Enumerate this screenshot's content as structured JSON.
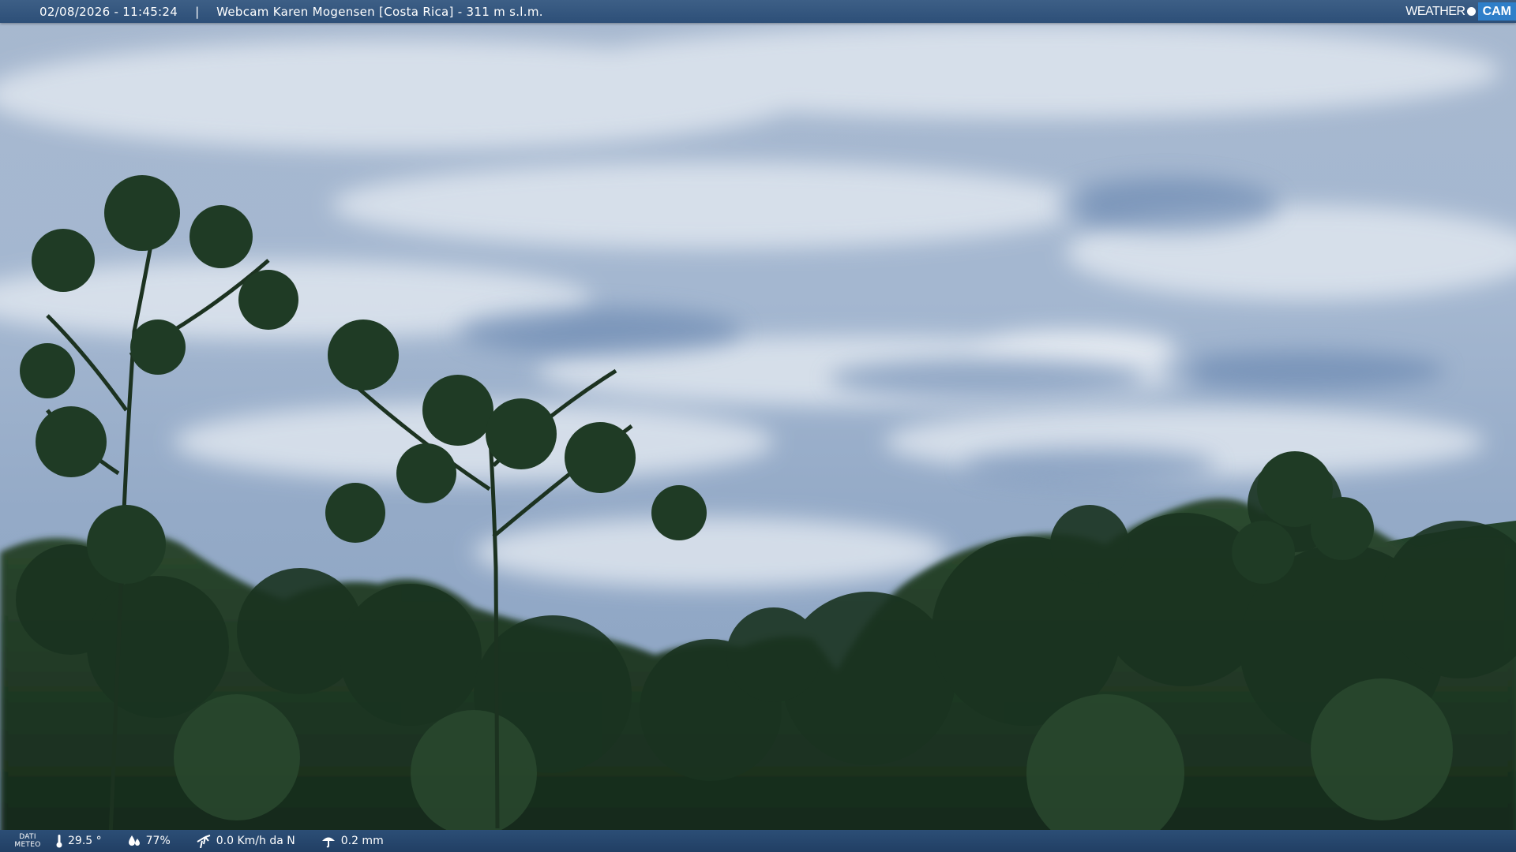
{
  "header": {
    "datetime": "02/08/2026 - 11:45:24",
    "separator": "|",
    "title": "Webcam Karen Mogensen [Costa Rica]  - 311 m s.l.m."
  },
  "logo": {
    "weather": "WEATHER",
    "cam": "CAM"
  },
  "footer": {
    "meteo_label_line1": "DATI",
    "meteo_label_line2": "METEO",
    "temperature": "29.5 °",
    "humidity": "77%",
    "wind": "0.0 Km/h da N",
    "rain": "0.2 mm"
  },
  "icons": [
    "thermometer-icon",
    "humidity-icon",
    "wind-icon",
    "rain-icon"
  ],
  "colors": {
    "bar": "#2d4f78",
    "logo_accent": "#2f7fc9",
    "foliage": "#1e3a24"
  }
}
